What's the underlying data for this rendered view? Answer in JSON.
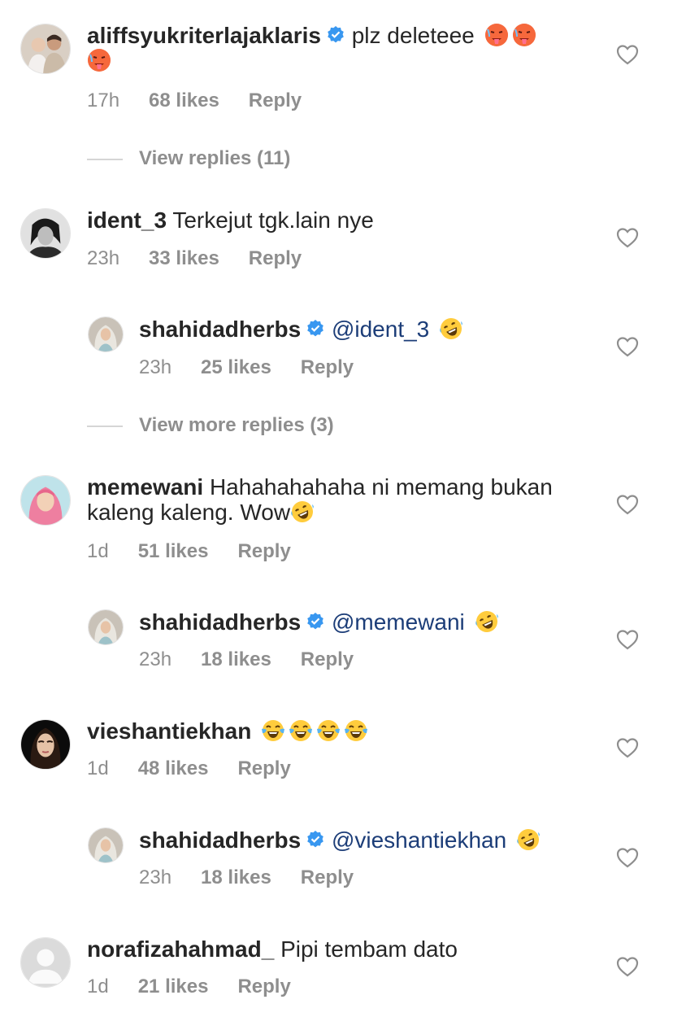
{
  "comments": [
    {
      "username": "aliffsyukriterlajaklaris",
      "verified": true,
      "text": "plz deleteee",
      "emojis": [
        "hot-face",
        "hot-face",
        "hot-face"
      ],
      "time": "17h",
      "likes": "68 likes",
      "reply": "Reply"
    },
    {
      "username": "ident_3",
      "verified": false,
      "text": "Terkejut tgk.lain nye",
      "time": "23h",
      "likes": "33 likes",
      "reply": "Reply"
    },
    {
      "username": "shahidadherbs",
      "verified": true,
      "mention": "@ident_3",
      "emojis": [
        "rofl-face"
      ],
      "time": "23h",
      "likes": "25 likes",
      "reply": "Reply"
    },
    {
      "username": "memewani",
      "verified": false,
      "text_line1": "Hahahahahaha ni memang bukan",
      "text_line2": "kaleng kaleng. Wow",
      "emojis": [
        "rofl-face"
      ],
      "time": "1d",
      "likes": "51 likes",
      "reply": "Reply"
    },
    {
      "username": "shahidadherbs",
      "verified": true,
      "mention": "@memewani",
      "emojis": [
        "rofl-face"
      ],
      "time": "23h",
      "likes": "18 likes",
      "reply": "Reply"
    },
    {
      "username": "vieshantiekhan",
      "verified": false,
      "emojis": [
        "tears-of-joy-face",
        "tears-of-joy-face",
        "tears-of-joy-face",
        "tears-of-joy-face"
      ],
      "time": "1d",
      "likes": "48 likes",
      "reply": "Reply"
    },
    {
      "username": "shahidadherbs",
      "verified": true,
      "mention": "@vieshantiekhan",
      "emojis": [
        "rofl-face"
      ],
      "time": "23h",
      "likes": "18 likes",
      "reply": "Reply"
    },
    {
      "username": "norafizahahmad_",
      "verified": false,
      "text": "Pipi tembam dato",
      "time": "1d",
      "likes": "21 likes",
      "reply": "Reply"
    }
  ],
  "view_replies": [
    {
      "label": "View replies (11)"
    },
    {
      "label": "View more replies (3)"
    }
  ],
  "colors": {
    "text": "#262626",
    "meta": "#8e8e8e",
    "mention": "#1c3d78",
    "verified": "#3897f0"
  }
}
